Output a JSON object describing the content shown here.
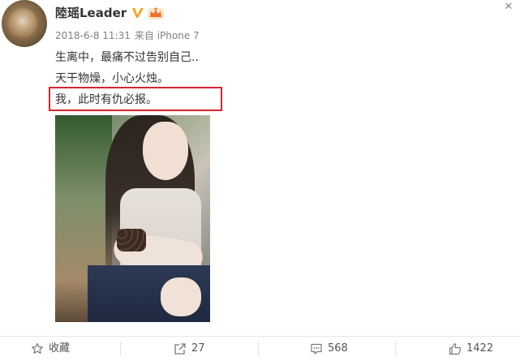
{
  "post": {
    "username": "陸瑶Leader",
    "verified_icon": "verified-v-icon",
    "vip_icon": "vip-crown-icon",
    "close_icon": "close-icon",
    "meta": {
      "date": "2018-6-8 11:31",
      "source": "来自 iPhone 7"
    },
    "text_lines": [
      "生离中，最痛不过告别自己..",
      "天干物燥，小心火烛。",
      "我，此时有仇必报。"
    ],
    "highlight_color": "#d3262e",
    "photo": {
      "icon": "post-photo"
    }
  },
  "actions": {
    "collect_label": "收藏",
    "repost_count": "27",
    "comment_count": "568",
    "like_count": "1422"
  }
}
